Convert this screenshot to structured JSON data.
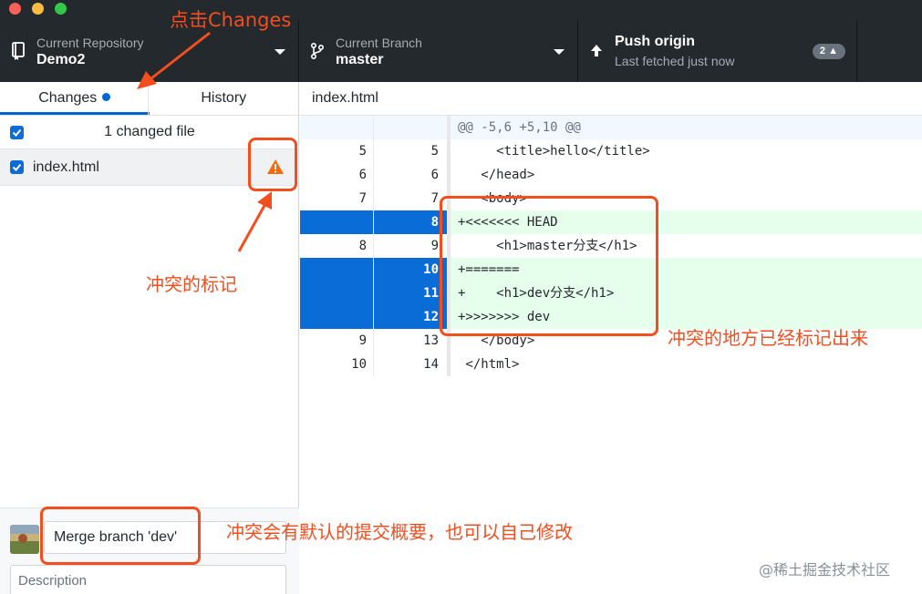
{
  "toolbar": {
    "repository": {
      "label": "Current Repository",
      "value": "Demo2"
    },
    "branch": {
      "label": "Current Branch",
      "value": "master"
    },
    "push": {
      "title": "Push origin",
      "subtitle": "Last fetched just now",
      "badge": "2"
    }
  },
  "sidebar": {
    "tabs": [
      {
        "label": "Changes",
        "active": true
      },
      {
        "label": "History",
        "active": false
      }
    ],
    "changed_summary": "1 changed file",
    "files": [
      {
        "name": "index.html",
        "status": "conflict"
      }
    ],
    "commit": {
      "summary": "Merge branch 'dev'",
      "description_placeholder": "Description"
    }
  },
  "diff": {
    "file": "index.html",
    "lines": [
      {
        "type": "hunk",
        "old": "",
        "new": "",
        "text": "@@ -5,6 +5,10 @@"
      },
      {
        "type": "ctx",
        "old": "5",
        "new": "5",
        "text": "     <title>hello</title>"
      },
      {
        "type": "ctx",
        "old": "6",
        "new": "6",
        "text": "   </head>"
      },
      {
        "type": "ctx",
        "old": "7",
        "new": "7",
        "text": "   <body>"
      },
      {
        "type": "add",
        "old": "",
        "new": "8",
        "text": "+<<<<<<< HEAD"
      },
      {
        "type": "ctx",
        "old": "8",
        "new": "9",
        "text": "     <h1>master分支</h1>"
      },
      {
        "type": "add",
        "old": "",
        "new": "10",
        "text": "+======="
      },
      {
        "type": "add",
        "old": "",
        "new": "11",
        "text": "+    <h1>dev分支</h1>"
      },
      {
        "type": "add",
        "old": "",
        "new": "12",
        "text": "+>>>>>>> dev"
      },
      {
        "type": "ctx",
        "old": "9",
        "new": "13",
        "text": "   </body>"
      },
      {
        "type": "ctx",
        "old": "10",
        "new": "14",
        "text": " </html>"
      }
    ]
  },
  "annotations": {
    "click_changes": "点击Changes",
    "conflict_mark": "冲突的标记",
    "conflict_location": "冲突的地方已经标记出来",
    "default_summary": "冲突会有默认的提交概要，也可以自己修改"
  },
  "watermark": "@稀土掘金技术社区",
  "colors": {
    "accent": "#0366d6",
    "annotation": "#f24e1e",
    "toolbar": "#24292e",
    "warning": "#f66a0a"
  }
}
